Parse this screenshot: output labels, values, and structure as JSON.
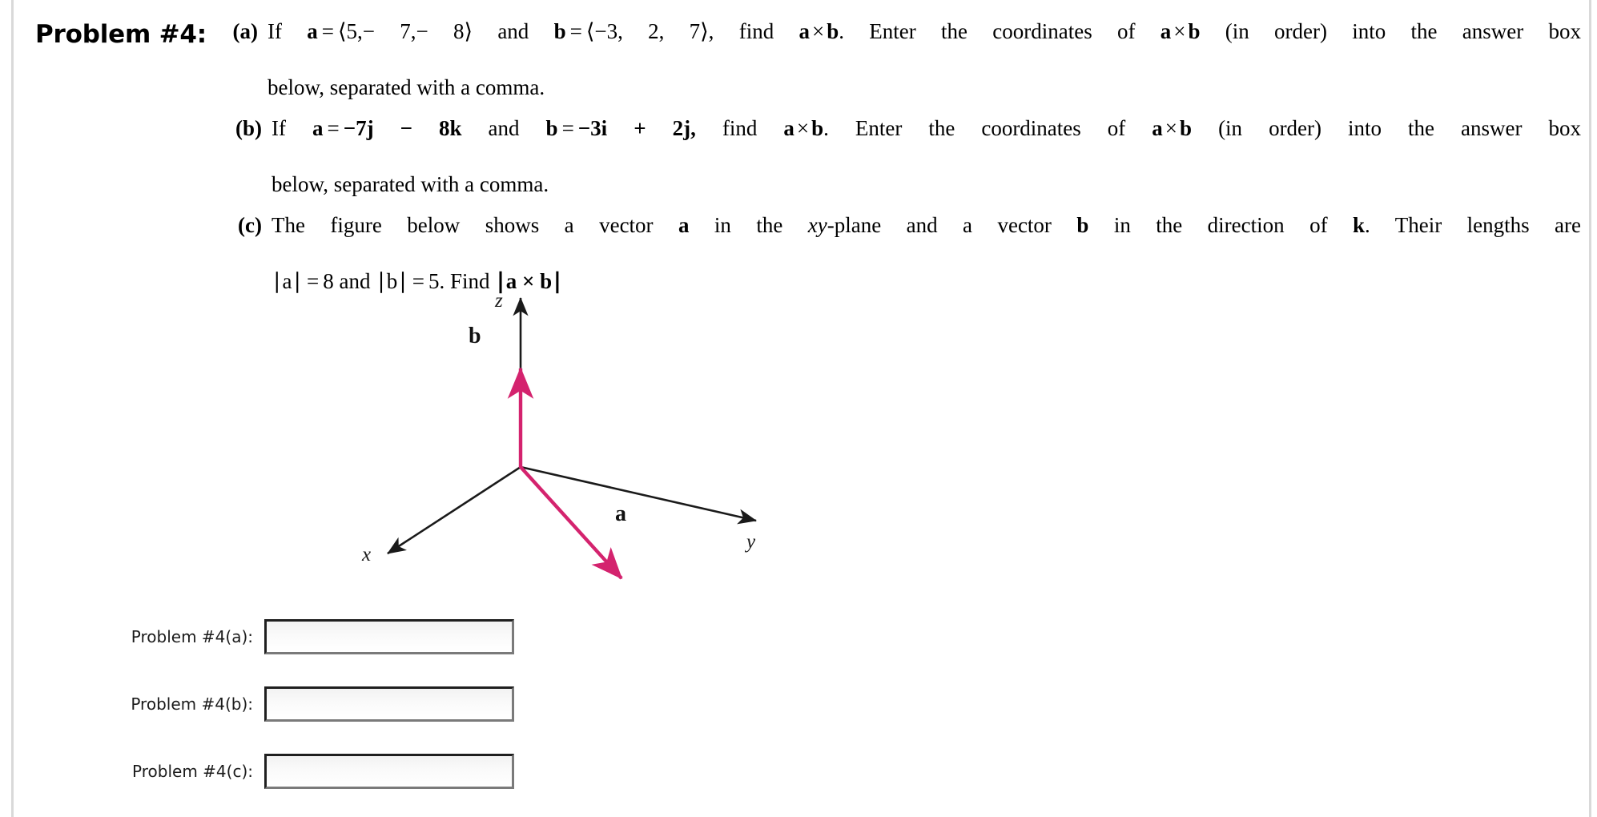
{
  "page": {
    "title": "Problem #4:",
    "rule_color": "#d9d9d9",
    "accent_color": "#d4236e"
  },
  "parts": {
    "a": {
      "label": "(a)",
      "line1_pre": "If ",
      "vec_a": "a",
      "eq1": "=",
      "a_value": "⟨5,− 7,− 8⟩",
      "mid": " and ",
      "vec_b": "b",
      "eq2": "=",
      "b_value": "⟨−3, 2, 7⟩,",
      "find": " find ",
      "cross_a": "a",
      "cross_sym": "×",
      "cross_b": "b",
      "line1_post": ". Enter the coordinates of ",
      "line1_tail": " (in order) into the answer box",
      "line2": "below, separated with a comma."
    },
    "b": {
      "label": "(b)",
      "line1_pre": "If ",
      "vec_a": "a",
      "eq1": "=",
      "a_value": "−7j − 8k",
      "mid": " and ",
      "vec_b": "b",
      "eq2": "=",
      "b_value": "−3i + 2j,",
      "find": " find ",
      "cross_a": "a",
      "cross_sym": "×",
      "cross_b": "b",
      "line1_post": ". Enter the coordinates of ",
      "line1_tail": " (in order) into the answer box",
      "line2": "below, separated with a comma."
    },
    "c": {
      "label": "(c)",
      "line1_s1": "The figure below shows a vector ",
      "vec_a": "a",
      "line1_s2": " in the ",
      "xy": "xy",
      "line1_s3": "-plane and a vector ",
      "vec_b": "b",
      "line1_s4": " in the direction of ",
      "vec_k": "k",
      "line1_s5": ". Their lengths are",
      "line2_a": "∣a∣",
      "line2_eq1": "=",
      "line2_v1": "8 and ",
      "line2_b": "∣b∣",
      "line2_eq2": "=",
      "line2_v2": "5. Find ",
      "line2_cross": "∣a × b∣"
    }
  },
  "figure": {
    "axis_z": "z",
    "axis_x": "x",
    "axis_y": "y",
    "vector_a": "a",
    "vector_b": "b",
    "vector_color": "#d4236e",
    "axis_color": "#1a1a1a"
  },
  "answers": [
    {
      "label": "Problem #4(a):",
      "value": "",
      "placeholder": ""
    },
    {
      "label": "Problem #4(b):",
      "value": "",
      "placeholder": ""
    },
    {
      "label": "Problem #4(c):",
      "value": "",
      "placeholder": ""
    }
  ]
}
